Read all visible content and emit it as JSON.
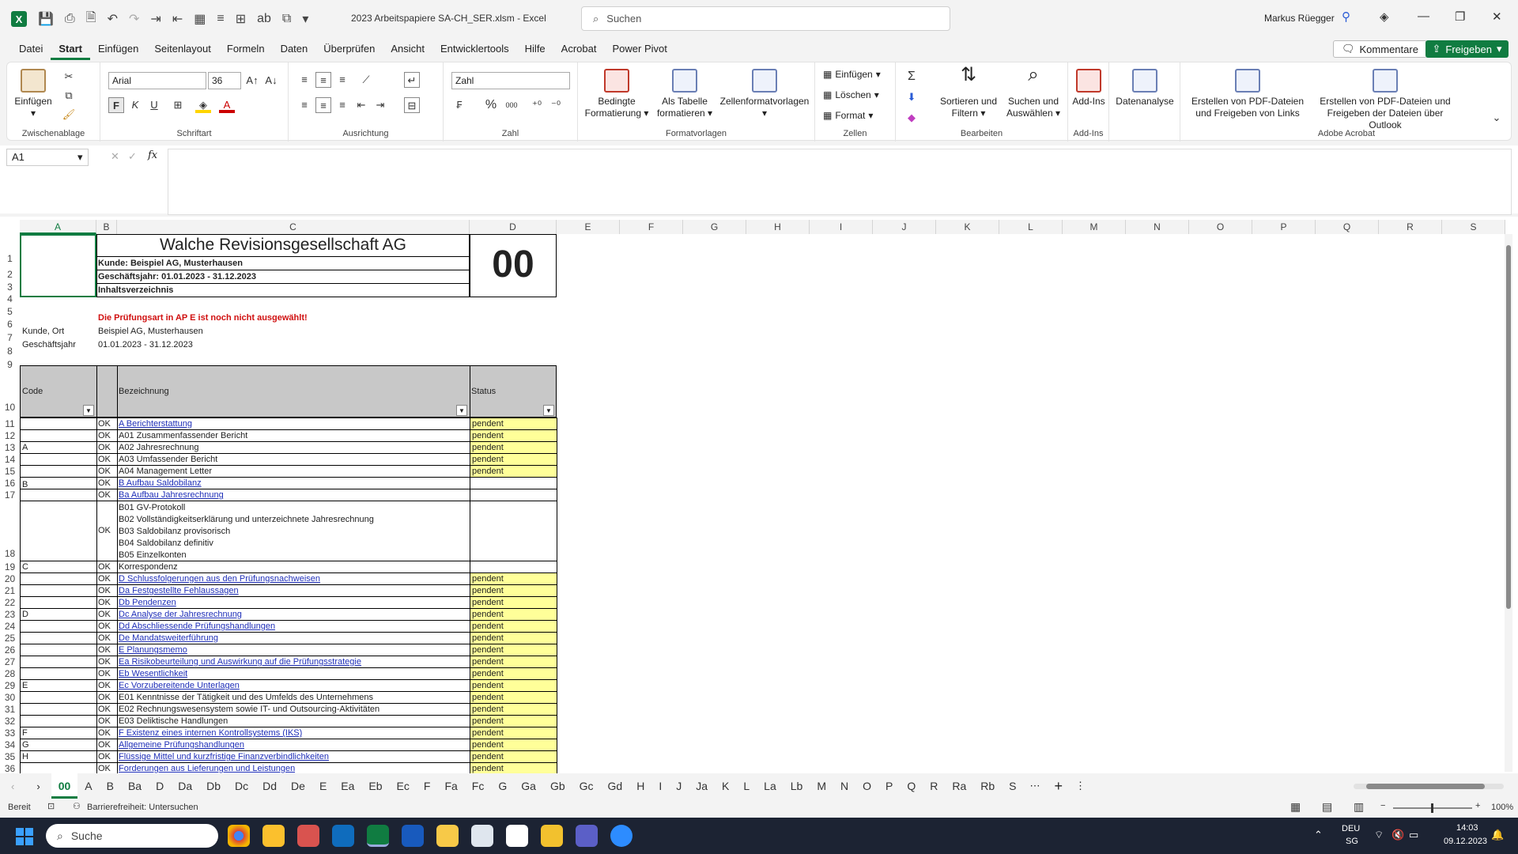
{
  "titlebar": {
    "doc_title": "2023 Arbeitspapiere SA-CH_SER.xlsm  -  Excel",
    "search_placeholder": "Suchen",
    "user": "Markus Rüegger"
  },
  "menu": {
    "tabs": [
      "Datei",
      "Start",
      "Einfügen",
      "Seitenlayout",
      "Formeln",
      "Daten",
      "Überprüfen",
      "Ansicht",
      "Entwicklertools",
      "Hilfe",
      "Acrobat",
      "Power Pivot"
    ],
    "active": "Start",
    "kommentare": "Kommentare",
    "freigeben": "Freigeben"
  },
  "ribbon": {
    "clipboard": {
      "label": "Zwischenablage",
      "paste": "Einfügen"
    },
    "font": {
      "label": "Schriftart",
      "name": "Arial",
      "size": "36",
      "bold": "F",
      "italic": "K",
      "underline": "U"
    },
    "alignment": {
      "label": "Ausrichtung"
    },
    "number": {
      "label": "Zahl",
      "format": "Zahl",
      "percent": "%",
      "thousands": "000"
    },
    "styles": {
      "label": "Formatvorlagen",
      "conditional": "Bedingte Formatierung",
      "as_table": "Als Tabelle formatieren",
      "cell_styles": "Zellenformatvorlagen"
    },
    "cells": {
      "label": "Zellen",
      "insert": "Einfügen",
      "delete": "Löschen",
      "format": "Format"
    },
    "editing": {
      "label": "Bearbeiten",
      "sort": "Sortieren und Filtern",
      "find": "Suchen und Auswählen"
    },
    "addins": {
      "label": "Add-Ins",
      "btn": "Add-Ins"
    },
    "analysis": {
      "btn": "Datenanalyse"
    },
    "acrobat": {
      "label": "Adobe Acrobat",
      "pdf1": "Erstellen von PDF-Dateien und Freigeben von Links",
      "pdf2": "Erstellen von PDF-Dateien und Freigeben der Dateien über Outlook"
    }
  },
  "formula": {
    "namebox": "A1",
    "fx": "fx",
    "content": ""
  },
  "columns": [
    "A",
    "B",
    "C",
    "D",
    "E",
    "F",
    "G",
    "H",
    "I",
    "J",
    "K",
    "L",
    "M",
    "N",
    "O",
    "P",
    "Q",
    "R",
    "S"
  ],
  "sheet": {
    "company": "Walche Revisionsgesellschaft AG",
    "client_line": "Kunde: Beispiel AG, Musterhausen",
    "fy_line": "Geschäftsjahr: 01.01.2023 - 31.12.2023",
    "toc": "Inhaltsverzeichnis",
    "code": "00",
    "warning": "Die Prüfungsart in AP E ist noch nicht ausgewählt!",
    "kunde_label": "Kunde, Ort",
    "kunde_value": "Beispiel AG, Musterhausen",
    "gj_label": "Geschäftsjahr",
    "gj_value": "01.01.2023 - 31.12.2023",
    "hdr_code": "Code",
    "hdr_bez": "Bezeichnung",
    "hdr_status": "Status",
    "rows": [
      {
        "r": "11",
        "code": "",
        "ok": "OK",
        "bez": "A Berichterstattung",
        "link": true,
        "status": "pendent"
      },
      {
        "r": "12",
        "code": "",
        "ok": "OK",
        "bez": "A01 Zusammenfassender Bericht",
        "link": false,
        "status": "pendent"
      },
      {
        "r": "13",
        "code": "A",
        "ok": "OK",
        "bez": "A02 Jahresrechnung",
        "link": false,
        "status": "pendent"
      },
      {
        "r": "14",
        "code": "",
        "ok": "OK",
        "bez": "A03 Umfassender Bericht",
        "link": false,
        "status": "pendent"
      },
      {
        "r": "15",
        "code": "",
        "ok": "OK",
        "bez": "A04 Management Letter",
        "link": false,
        "status": "pendent"
      },
      {
        "r": "16",
        "code": "",
        "ok": "OK",
        "bez": "B Aufbau Saldobilanz",
        "link": true,
        "status": ""
      },
      {
        "r": "17",
        "code": "",
        "ok": "OK",
        "bez": "Ba Aufbau Jahresrechnung",
        "link": true,
        "status": ""
      }
    ],
    "row18": {
      "code": "B",
      "ok": "OK",
      "lines": [
        "B01 GV-Protokoll",
        "B02 Vollständigkeitserklärung und unterzeichnete Jahresrechnung",
        "B03 Saldobilanz provisorisch",
        "B04 Saldobilanz definitiv",
        "B05 Einzelkonten"
      ]
    },
    "rows2": [
      {
        "r": "19",
        "code": "C",
        "ok": "OK",
        "bez": "Korrespondenz",
        "link": false,
        "status": ""
      },
      {
        "r": "20",
        "code": "",
        "ok": "OK",
        "bez": "D Schlussfolgerungen aus den Prüfungsnachweisen",
        "link": true,
        "status": "pendent"
      },
      {
        "r": "21",
        "code": "",
        "ok": "OK",
        "bez": "Da Festgestellte Fehlaussagen",
        "link": true,
        "status": "pendent"
      },
      {
        "r": "22",
        "code": "",
        "ok": "OK",
        "bez": "Db Pendenzen",
        "link": true,
        "status": "pendent"
      },
      {
        "r": "23",
        "code": "D",
        "ok": "OK",
        "bez": "Dc Analyse der Jahresrechnung",
        "link": true,
        "status": "pendent"
      },
      {
        "r": "24",
        "code": "",
        "ok": "OK",
        "bez": "Dd Abschliessende Prüfungshandlungen",
        "link": true,
        "status": "pendent"
      },
      {
        "r": "25",
        "code": "",
        "ok": "OK",
        "bez": "De Mandatsweiterführung",
        "link": true,
        "status": "pendent"
      },
      {
        "r": "26",
        "code": "",
        "ok": "OK",
        "bez": "E Planungsmemo",
        "link": true,
        "status": "pendent"
      },
      {
        "r": "27",
        "code": "",
        "ok": "OK",
        "bez": "Ea Risikobeurteilung und Auswirkung auf die Prüfungsstrategie",
        "link": true,
        "status": "pendent"
      },
      {
        "r": "28",
        "code": "",
        "ok": "OK",
        "bez": "Eb Wesentlichkeit",
        "link": true,
        "status": "pendent"
      },
      {
        "r": "29",
        "code": "E",
        "ok": "OK",
        "bez": "Ec Vorzubereitende Unterlagen",
        "link": true,
        "status": "pendent"
      },
      {
        "r": "30",
        "code": "",
        "ok": "OK",
        "bez": "E01 Kenntnisse der Tätigkeit und des Umfelds des Unternehmens",
        "link": false,
        "status": "pendent"
      },
      {
        "r": "31",
        "code": "",
        "ok": "OK",
        "bez": "E02 Rechnungswesensystem sowie IT- und Outsourcing-Aktivitäten",
        "link": false,
        "status": "pendent"
      },
      {
        "r": "32",
        "code": "",
        "ok": "OK",
        "bez": "E03 Deliktische Handlungen",
        "link": false,
        "status": "pendent"
      },
      {
        "r": "33",
        "code": "F",
        "ok": "OK",
        "bez": "F Existenz eines internen Kontrollsystems (IKS)",
        "link": true,
        "status": "pendent"
      },
      {
        "r": "34",
        "code": "G",
        "ok": "OK",
        "bez": "Allgemeine Prüfungshandlungen",
        "link": true,
        "status": "pendent"
      },
      {
        "r": "35",
        "code": "H",
        "ok": "OK",
        "bez": "Flüssige Mittel und kurzfristige Finanzverbindlichkeiten",
        "link": true,
        "status": "pendent"
      },
      {
        "r": "36",
        "code": "",
        "ok": "OK",
        "bez": "Forderungen aus Lieferungen und Leistungen",
        "link": true,
        "status": "pendent"
      }
    ]
  },
  "sheet_tabs": [
    "00",
    "A",
    "B",
    "Ba",
    "D",
    "Da",
    "Db",
    "Dc",
    "Dd",
    "De",
    "E",
    "Ea",
    "Eb",
    "Ec",
    "F",
    "Fa",
    "Fc",
    "G",
    "Ga",
    "Gb",
    "Gc",
    "Gd",
    "H",
    "I",
    "J",
    "Ja",
    "K",
    "L",
    "La",
    "Lb",
    "M",
    "N",
    "O",
    "P",
    "Q",
    "R",
    "Ra",
    "Rb",
    "S"
  ],
  "status": {
    "ready": "Bereit",
    "accessibility": "Barrierefreiheit: Untersuchen",
    "zoom": "100%"
  },
  "taskbar": {
    "search": "Suche",
    "lang": "DEU",
    "region": "SG",
    "time": "14:03",
    "date": "09.12.2023"
  }
}
